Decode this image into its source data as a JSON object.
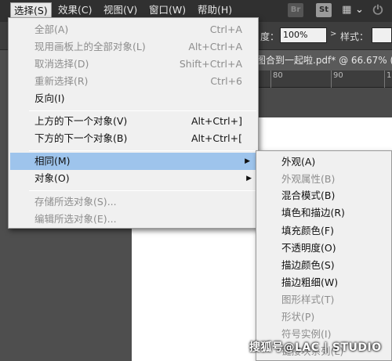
{
  "menubar": {
    "items": [
      "选择(S)",
      "效果(C)",
      "视图(V)",
      "窗口(W)",
      "帮助(H)"
    ],
    "active_index": 0,
    "icons": {
      "bridge": "Br",
      "stock": "St"
    }
  },
  "controlbar": {
    "opacity_label": "度：",
    "opacity_value": "100%",
    "style_label": "样式："
  },
  "document": {
    "tab_title": "图合到一起啦.pdf* @ 66.67% (",
    "ruler_numbers": [
      "80",
      "90",
      "1"
    ]
  },
  "select_menu": {
    "items": [
      {
        "label": "全部(A)",
        "shortcut": "Ctrl+A",
        "disabled": true
      },
      {
        "label": "现用画板上的全部对象(L)",
        "shortcut": "Alt+Ctrl+A",
        "disabled": true
      },
      {
        "label": "取消选择(D)",
        "shortcut": "Shift+Ctrl+A",
        "disabled": true
      },
      {
        "label": "重新选择(R)",
        "shortcut": "Ctrl+6",
        "disabled": true
      },
      {
        "label": "反向(I)",
        "shortcut": "",
        "disabled": false
      },
      {
        "label": "上方的下一个对象(V)",
        "shortcut": "Alt+Ctrl+]",
        "disabled": false
      },
      {
        "label": "下方的下一个对象(B)",
        "shortcut": "Alt+Ctrl+[",
        "disabled": false
      },
      {
        "label": "相同(M)",
        "shortcut": "",
        "disabled": false,
        "submenu": true,
        "highlighted": true
      },
      {
        "label": "对象(O)",
        "shortcut": "",
        "disabled": false,
        "submenu": true
      },
      {
        "label": "存储所选对象(S)...",
        "shortcut": "",
        "disabled": true
      },
      {
        "label": "编辑所选对象(E)...",
        "shortcut": "",
        "disabled": true
      }
    ]
  },
  "same_submenu": {
    "items": [
      {
        "label": "外观(A)",
        "disabled": false
      },
      {
        "label": "外观属性(B)",
        "disabled": true
      },
      {
        "label": "混合模式(B)",
        "disabled": false
      },
      {
        "label": "填色和描边(R)",
        "disabled": false
      },
      {
        "label": "填充颜色(F)",
        "disabled": false
      },
      {
        "label": "不透明度(O)",
        "disabled": false
      },
      {
        "label": "描边颜色(S)",
        "disabled": false
      },
      {
        "label": "描边粗细(W)",
        "disabled": false
      },
      {
        "label": "图形样式(T)",
        "disabled": true
      },
      {
        "label": "形状(P)",
        "disabled": true
      },
      {
        "label": "符号实例(I)",
        "disabled": true
      },
      {
        "label": "链接块系列(L)",
        "disabled": true
      }
    ]
  },
  "watermark": "搜狐号@LAC | STUDIO"
}
